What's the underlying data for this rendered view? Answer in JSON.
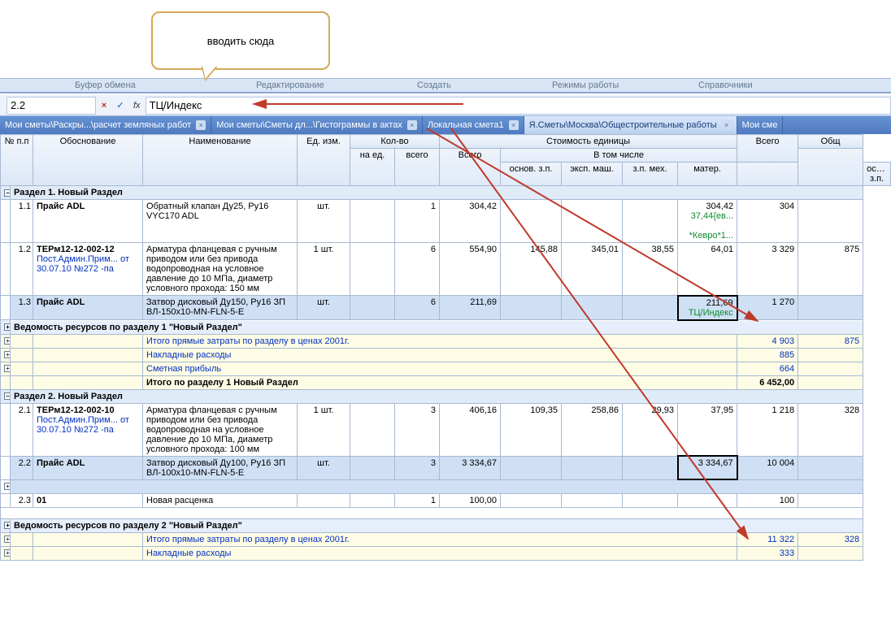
{
  "callout": {
    "text": "вводить сюда"
  },
  "ribbon": {
    "g1": "Буфер обмена",
    "g2": "Редактирование",
    "g3": "Создать",
    "g4": "Режимы работы",
    "g5": "Справочники"
  },
  "formula_bar": {
    "cellref": "2.2",
    "fx": "fx",
    "value": "ТЦ/Индекс"
  },
  "tabs": [
    {
      "label": "Мои сметы\\Раскры...\\расчет земляных работ"
    },
    {
      "label": "Мои сметы\\Сметы дл...\\Гистограммы в актах"
    },
    {
      "label": "Локальная смета1"
    },
    {
      "label": "Я.Сметы\\Москва\\Общестроительные работы",
      "active": true
    },
    {
      "label": "Мои сме"
    }
  ],
  "headers": {
    "r1": {
      "num": "№ п.п",
      "obos": "Обоснование",
      "naim": "Наименование",
      "ed": "Ед. изм.",
      "kolvo": "Кол-во",
      "stoimed": "Стоимость единицы",
      "obsh": "Общ"
    },
    "r2": {
      "naed": "на ед.",
      "vsego": "всего",
      "vsego2": "Всего",
      "vtom": "В том числе",
      "vsego3": "Всего"
    },
    "r3": {
      "osn": "основ. з.п.",
      "eksp": "эксп. маш.",
      "zpmeh": "з.п. мех.",
      "mater": "матер.",
      "osn2": "основ. з.п."
    }
  },
  "sections": {
    "s1": "Раздел 1. Новый Раздел",
    "s2": "Раздел 2. Новый Раздел"
  },
  "rows": {
    "r11": {
      "num": "1.1",
      "ob": "Прайс ADL",
      "name": "Обратный клапан Ду25, Ру16 VYC170     ADL",
      "ed": "шт.",
      "naed": "",
      "vsego": "1",
      "vsego2": "304,42",
      "mater": "304,42",
      "mater2": "37,44{ев...",
      "mater3": "*Кевро*1...",
      "tot": "304"
    },
    "r12": {
      "num": "1.2",
      "ob": "ТЕРм12-12-002-12",
      "ob2": "Пост.Админ.Прим... от 30.07.10 №272 -па",
      "name": "Арматура фланцевая с ручным приводом или без привода водопроводная на условное давление до 10 МПа, диаметр условного прохода: 150 мм",
      "ed": "1 шт.",
      "vsego": "6",
      "vsego2": "554,90",
      "osn": "145,88",
      "eksp": "345,01",
      "zpm": "38,55",
      "mat": "64,01",
      "tot": "3 329",
      "oszp": "875"
    },
    "r13": {
      "num": "1.3",
      "ob": "Прайс ADL",
      "name": "Затвор дисковый Ду150, Ру16 ЗП ВЛ-150x10-MN-FLN-5-E",
      "ed": "шт.",
      "vsego": "6",
      "vsego2": "211,69",
      "mat": "211,69",
      "mat2": "ТЦ/Индекс",
      "tot": "1 270"
    },
    "r21": {
      "num": "2.1",
      "ob": "ТЕРм12-12-002-10",
      "ob2": "Пост.Админ.Прим... от 30.07.10 №272 -па",
      "name": "Арматура фланцевая с ручным приводом или без привода водопроводная на условное давление до 10 МПа, диаметр условного прохода: 100 мм",
      "ed": "1 шт.",
      "vsego": "3",
      "vsego2": "406,16",
      "osn": "109,35",
      "eksp": "258,86",
      "zpm": "29,93",
      "mat": "37,95",
      "tot": "1 218",
      "oszp": "328"
    },
    "r22": {
      "num": "2.2",
      "ob": "Прайс ADL",
      "name": "Затвор дисковый Ду100, Ру16 ЗП ВЛ-100x10-MN-FLN-5-E",
      "ed": "шт.",
      "vsego": "3",
      "vsego2": "3 334,67",
      "mat": "3 334,67",
      "tot": "10 004"
    },
    "r23": {
      "num": "2.3",
      "ob": "01",
      "name": "Новая расценка",
      "ed": "",
      "vsego": "1",
      "vsego2": "100,00",
      "tot": "100"
    }
  },
  "subtotals": {
    "ved1": "Ведомость ресурсов по разделу 1 \"Новый Раздел\"",
    "it1": "Итого прямые затраты по разделу в ценах 2001г.",
    "it1v": "4 903",
    "it1o": "875",
    "nr": "Накладные расходы",
    "nrv": "885",
    "sp": "Сметная прибыль",
    "spv": "664",
    "itr1": "Итого по разделу 1 Новый Раздел",
    "itr1v": "6 452,00",
    "ved2": "Ведомость ресурсов по разделу 2 \"Новый Раздел\"",
    "it2": "Итого прямые затраты по разделу в ценах 2001г.",
    "it2v": "11 322",
    "it2o": "328",
    "nr2": "Накладные расходы",
    "nr2v": "333"
  },
  "icons": {
    "plus": "+",
    "minus": "−",
    "x": "×",
    "check": "✓"
  }
}
